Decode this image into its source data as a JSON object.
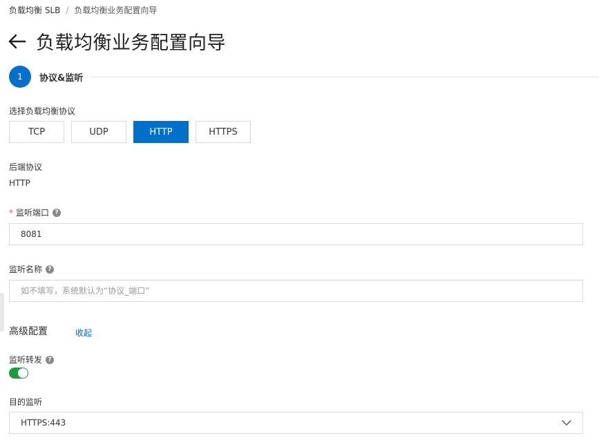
{
  "breadcrumb": {
    "root": "负载均衡 SLB",
    "separator": "/",
    "current": "负载均衡业务配置向导"
  },
  "page": {
    "title": "负载均衡业务配置向导"
  },
  "step": {
    "number": "1",
    "label": "协议&监听"
  },
  "protocol": {
    "label": "选择负载均衡协议",
    "options": [
      "TCP",
      "UDP",
      "HTTP",
      "HTTPS"
    ],
    "selected": "HTTP"
  },
  "backend": {
    "label": "后端协议",
    "value": "HTTP"
  },
  "port": {
    "label": "监听端口",
    "required_mark": "*",
    "value": "8081"
  },
  "name": {
    "label": "监听名称",
    "placeholder": "如不填写，系统默认为“协议_端口”"
  },
  "advanced": {
    "title": "高级配置",
    "collapse_label": "收起"
  },
  "redirect": {
    "label": "监听转发",
    "enabled": true
  },
  "target": {
    "label": "目的监听",
    "value": "HTTPS:443"
  },
  "colors": {
    "primary": "#0070cc",
    "toggle_on": "#1a9c3c",
    "link": "#0064c8",
    "required": "#e84e4e"
  }
}
